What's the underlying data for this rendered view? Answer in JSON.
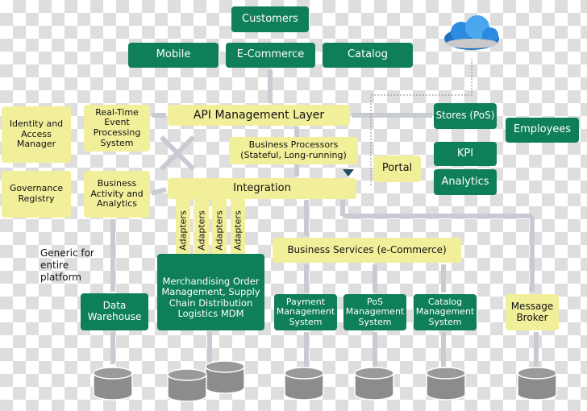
{
  "colors": {
    "green": "#0f7f57",
    "yellow": "#f2ef9b",
    "arrow": "#c8ccd2",
    "cylinder": "#8c8c8c"
  },
  "top": {
    "customers": "Customers",
    "mobile": "Mobile",
    "ecommerce": "E-Commerce",
    "catalog": "Catalog"
  },
  "cloud_icon": "cloud-icon",
  "left": {
    "identity": "Identity and Access Manager",
    "governance": "Governance Registry",
    "realtime": "Real-Time Event Processing System",
    "bam": "Business Activity and Analytics",
    "generic": "Generic for entire platform"
  },
  "middle": {
    "api": "API Management Layer",
    "processors": "Business Processors (Stateful, Long-running)",
    "portal": "Portal",
    "integration": "Integration",
    "adapters": [
      "Adapters",
      "Adapters",
      "Adapters",
      "Adapters"
    ],
    "business_services": "Business Services (e-Commerce)"
  },
  "right": {
    "stores": "Stores (PoS)",
    "employees": "Employees",
    "kpi": "KPI",
    "analytics": "Analytics"
  },
  "bottom": {
    "data_warehouse": "Data Warehouse",
    "merch": "Merchandising Order Management, Supply Chain Distribution Logistics MDM",
    "payment": "Payment Management System",
    "pos": "PoS Management System",
    "catalog_mgmt": "Catalog Management System",
    "broker": "Message Broker"
  }
}
